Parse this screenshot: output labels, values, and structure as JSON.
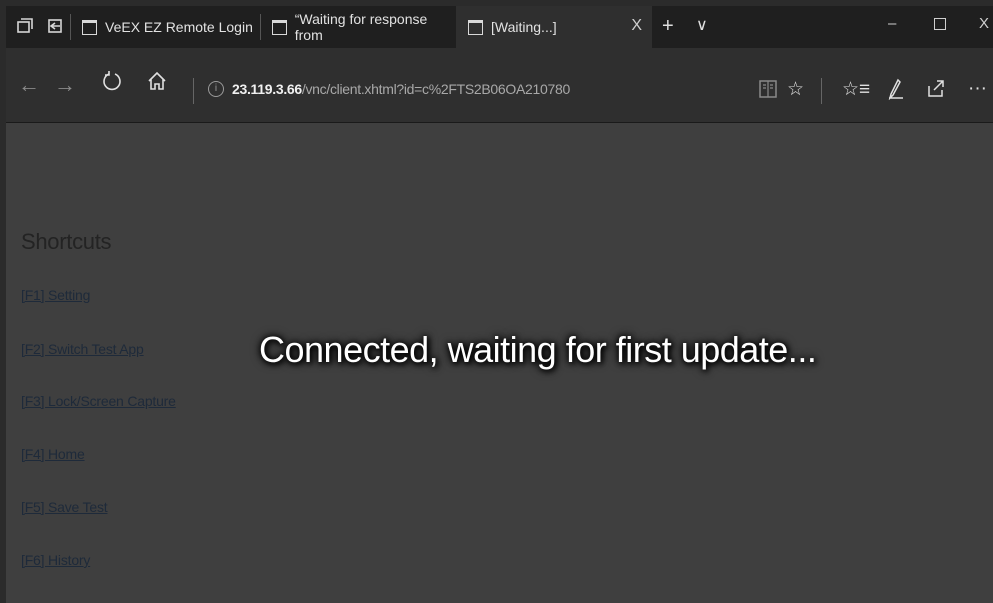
{
  "tabs": [
    {
      "title": "VeEX EZ Remote Login"
    },
    {
      "title": "“Waiting for response from"
    },
    {
      "title": "[Waiting...]",
      "active": true
    }
  ],
  "address": {
    "host": "23.119.3.66",
    "path": "/vnc/client.xhtml?id=c%2FTS2B06OA210780"
  },
  "content": {
    "shortcuts_title": "Shortcuts",
    "shortcuts": [
      {
        "label": "[F1] Setting"
      },
      {
        "label": "[F2] Switch Test App"
      },
      {
        "label": "[F3] Lock/Screen Capture"
      },
      {
        "label": "[F4] Home"
      },
      {
        "label": "[F5] Save Test"
      },
      {
        "label": "[F6] History"
      }
    ],
    "status": "Connected, waiting for first update..."
  },
  "icons": {
    "close_tab": "X",
    "new_tab": "+",
    "tab_list": "∨",
    "more": "···"
  }
}
